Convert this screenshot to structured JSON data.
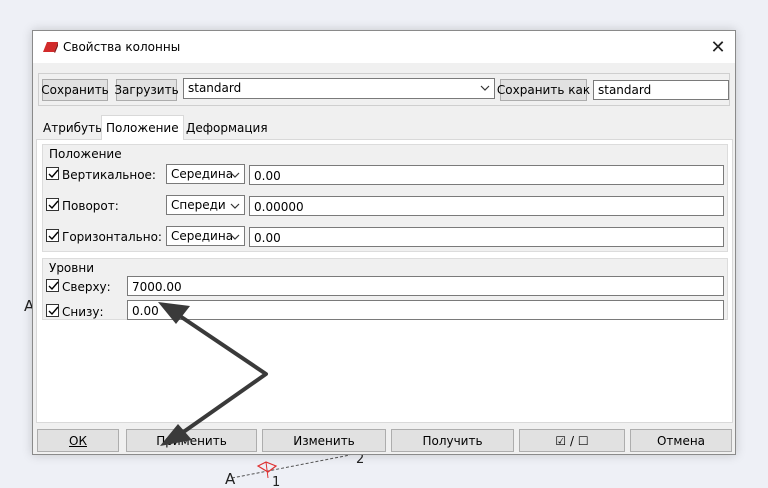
{
  "window": {
    "title": "Свойства колонны",
    "close_glyph": "✕"
  },
  "toolbar": {
    "save_label": "Сохранить",
    "load_label": "Загрузить",
    "preset_value": "standard",
    "save_as_label": "Сохранить как",
    "save_as_value": "standard"
  },
  "tabs": [
    {
      "label": "Атрибуты",
      "active": false
    },
    {
      "label": "Положение",
      "active": true
    },
    {
      "label": "Деформация",
      "active": false
    }
  ],
  "position_group": {
    "title": "Положение",
    "rows": [
      {
        "label": "Вертикальное:",
        "checked": true,
        "select": "Середина",
        "value": "0.00"
      },
      {
        "label": "Поворот:",
        "checked": true,
        "select": "Спереди",
        "value": "0.00000"
      },
      {
        "label": "Горизонтально:",
        "checked": true,
        "select": "Середина",
        "value": "0.00"
      }
    ]
  },
  "levels_group": {
    "title": "Уровни",
    "rows": [
      {
        "label": "Сверху:",
        "checked": true,
        "value": "7000.00"
      },
      {
        "label": "Снизу:",
        "checked": true,
        "value": "0.00"
      }
    ]
  },
  "footer": {
    "ok_label": "ОК",
    "apply_label": "Применить",
    "modify_label": "Изменить",
    "get_label": "Получить",
    "toggle_label": "☑ / ☐",
    "cancel_label": "Отмена"
  },
  "background": {
    "label_a_left": "A",
    "label_a_bottom": "A",
    "label_1": "1",
    "label_2": "2"
  },
  "colors": {
    "annotation_arrow": "#3a3a3a",
    "icon_red": "#d22b2b",
    "model_red": "#e03030"
  }
}
